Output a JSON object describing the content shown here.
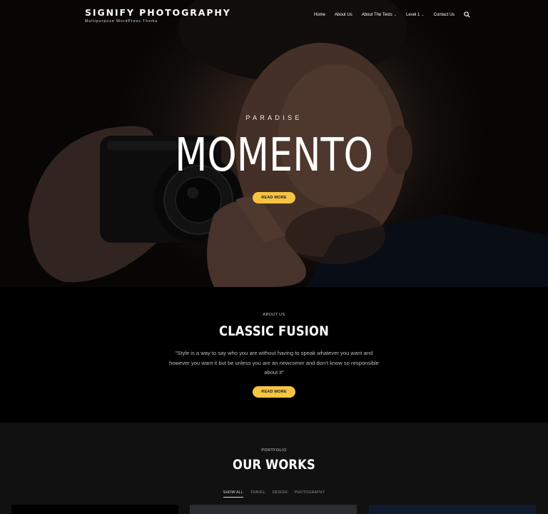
{
  "brand": {
    "name": "SIGNIFY PHOTOGRAPHY",
    "tagline": "Multipurpose WordPress Theme"
  },
  "nav": {
    "items": [
      {
        "label": "Home",
        "has_dropdown": false
      },
      {
        "label": "About Us",
        "has_dropdown": false
      },
      {
        "label": "About The Tests",
        "has_dropdown": true
      },
      {
        "label": "Level 1",
        "has_dropdown": true
      },
      {
        "label": "Contact Us",
        "has_dropdown": false
      }
    ],
    "search_icon": "search-icon"
  },
  "hero": {
    "eyebrow": "PARADISE",
    "title": "MOMENTO",
    "button_label": "READ MORE"
  },
  "about": {
    "eyebrow": "ABOUT US",
    "title": "CLASSIC FUSION",
    "quote": "“Style is a way to say who you are without having to speak whatever you want and however you want it but be unless you are an newcomer and don’t know so responsible about it”",
    "button_label": "READ MORE"
  },
  "portfolio": {
    "eyebrow": "PORTFOLIO",
    "title": "OUR WORKS",
    "filters": [
      "SHOW ALL",
      "TRAVEL",
      "DESIGN",
      "PHOTOGRAPHY"
    ],
    "active_filter": "SHOW ALL"
  },
  "colors": {
    "accent": "#f6c443",
    "about_bg": "#000000",
    "portfolio_bg": "#111111"
  }
}
